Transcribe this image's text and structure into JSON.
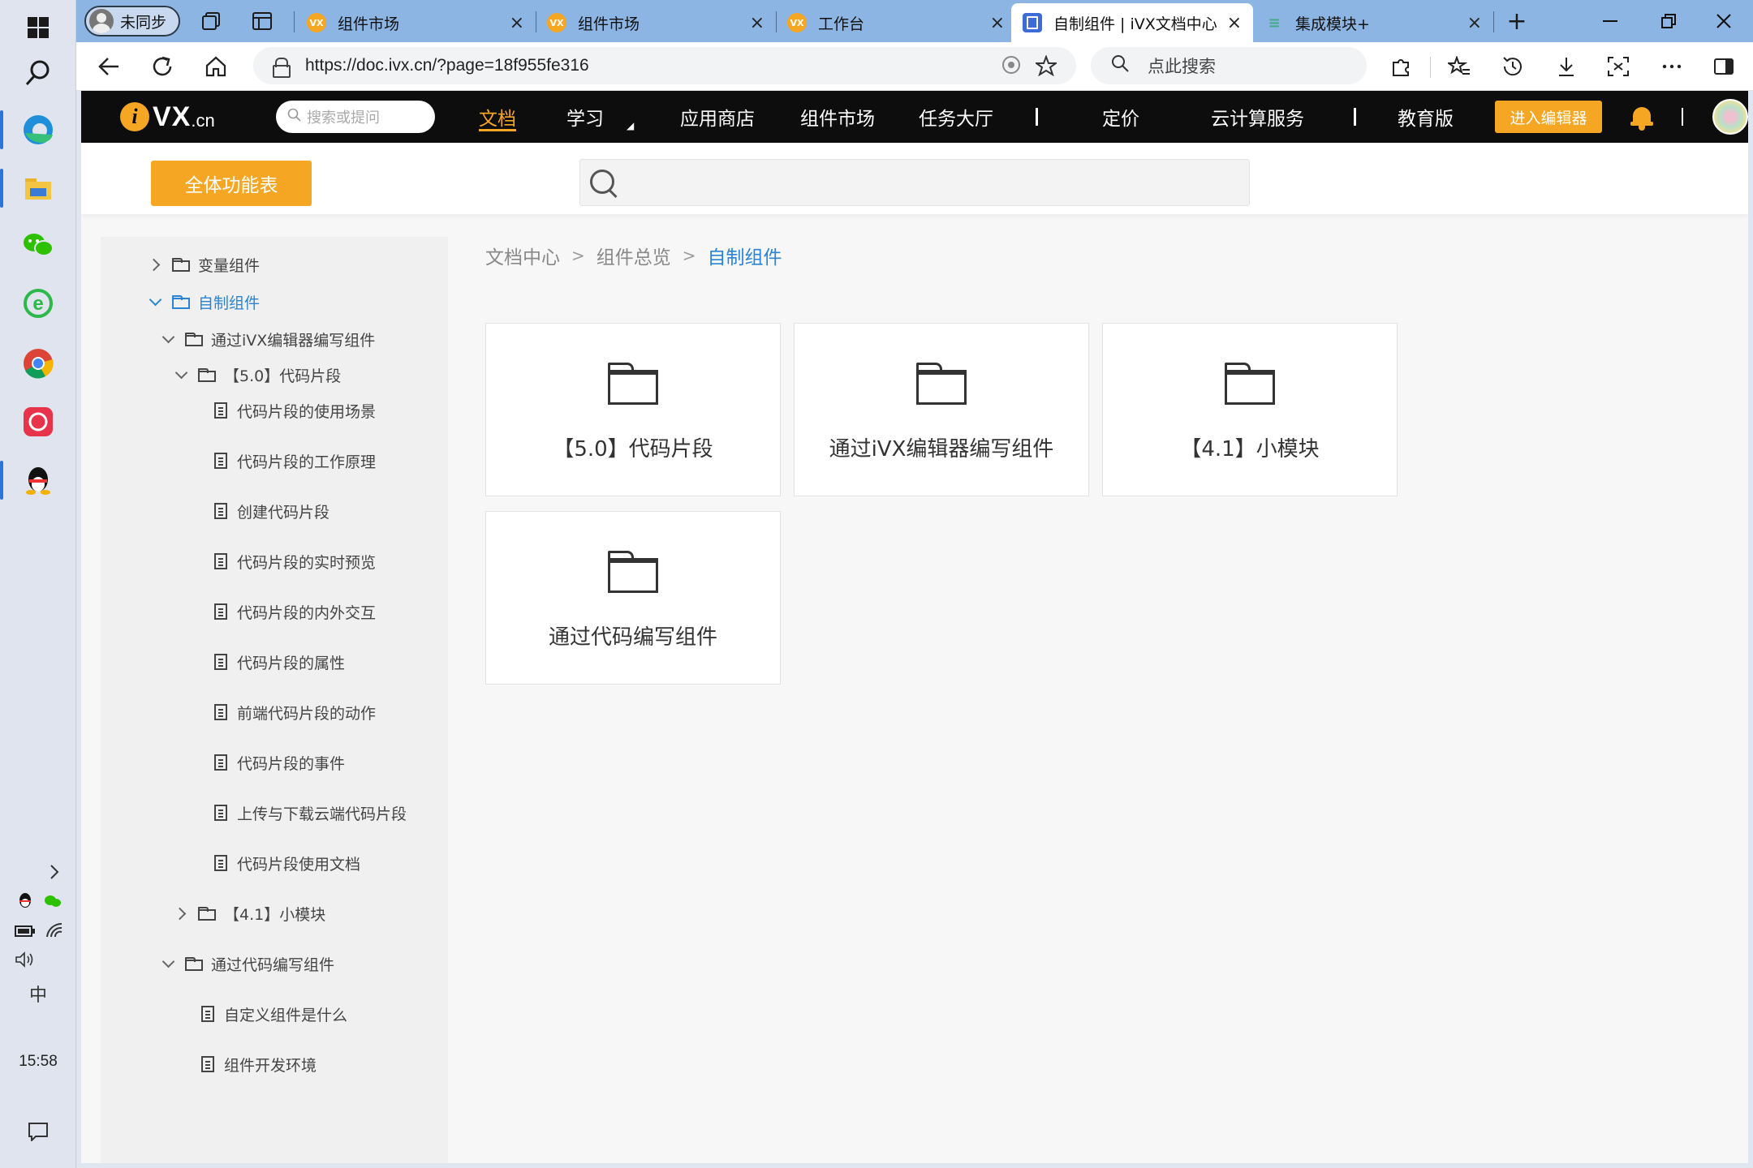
{
  "taskbar": {
    "clock": "15:58",
    "ime": "中"
  },
  "browser": {
    "profile_label": "未同步",
    "tabs": [
      {
        "label": "组件市场",
        "favicon": "vx-orange"
      },
      {
        "label": "组件市场",
        "favicon": "vx-orange"
      },
      {
        "label": "工作台",
        "favicon": "vx-orange"
      },
      {
        "label": "自制组件 | iVX文档中心",
        "favicon": "doc-blue",
        "active": true
      },
      {
        "label": "集成模块+",
        "favicon": "lines-green"
      }
    ],
    "new_tab": "+",
    "url": "https://doc.ivx.cn/?page=18f955fe316",
    "search_placeholder": "点此搜索"
  },
  "site": {
    "logo_i": "i",
    "logo_vx": "VX",
    "logo_cn": ".cn",
    "search_placeholder": "搜索或提问",
    "nav": {
      "docs": "文档",
      "learn": "学习",
      "app_store": "应用商店",
      "component_market": "组件市场",
      "task_hall": "任务大厅",
      "pricing": "定价",
      "cloud": "云计算服务",
      "education": "教育版"
    },
    "enter_editor": "进入编辑器",
    "accent_color": "#f5a623",
    "link_color": "#2a84d6"
  },
  "subheader": {
    "all_features": "全体功能表"
  },
  "sidebar": {
    "rows": [
      {
        "label": "变量组件",
        "type": "folder",
        "state": "collapsed"
      },
      {
        "label": "自制组件",
        "type": "folder",
        "state": "expanded",
        "selected": true
      },
      {
        "label": "通过iVX编辑器编写组件",
        "type": "folder",
        "state": "expanded"
      },
      {
        "label": "【5.0】代码片段",
        "type": "folder",
        "state": "expanded"
      },
      {
        "label": "代码片段的使用场景",
        "type": "doc"
      },
      {
        "label": "代码片段的工作原理",
        "type": "doc"
      },
      {
        "label": "创建代码片段",
        "type": "doc"
      },
      {
        "label": "代码片段的实时预览",
        "type": "doc"
      },
      {
        "label": "代码片段的内外交互",
        "type": "doc"
      },
      {
        "label": "代码片段的属性",
        "type": "doc"
      },
      {
        "label": "前端代码片段的动作",
        "type": "doc"
      },
      {
        "label": "代码片段的事件",
        "type": "doc"
      },
      {
        "label": "上传与下载云端代码片段",
        "type": "doc"
      },
      {
        "label": "代码片段使用文档",
        "type": "doc"
      },
      {
        "label": "【4.1】小模块",
        "type": "folder",
        "state": "collapsed"
      },
      {
        "label": "通过代码编写组件",
        "type": "folder",
        "state": "expanded"
      },
      {
        "label": "自定义组件是什么",
        "type": "doc"
      },
      {
        "label": "组件开发环境",
        "type": "doc"
      }
    ]
  },
  "breadcrumb": {
    "items": [
      "文档中心",
      "组件总览"
    ],
    "current": "自制组件",
    "separator": ">"
  },
  "cards": [
    {
      "label": "【5.0】代码片段"
    },
    {
      "label": "通过iVX编辑器编写组件"
    },
    {
      "label": "【4.1】小模块"
    },
    {
      "label": "通过代码编写组件"
    }
  ]
}
